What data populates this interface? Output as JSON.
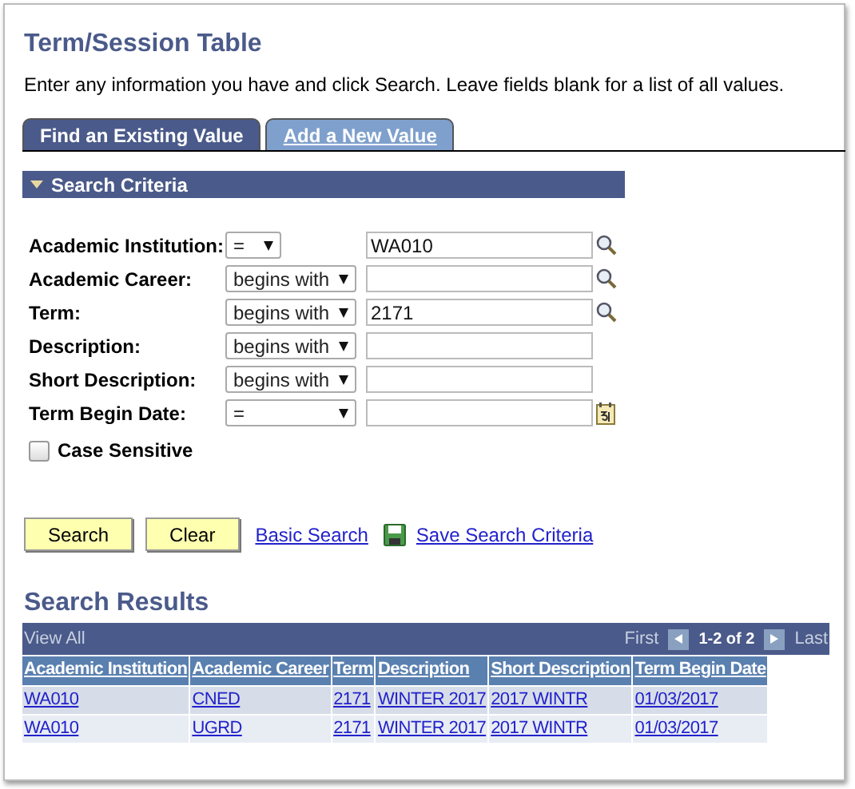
{
  "page": {
    "title": "Term/Session Table",
    "instructions": "Enter any information you have and click Search. Leave fields blank for a list of all values."
  },
  "tabs": [
    {
      "label": "Find an Existing Value",
      "selected": true
    },
    {
      "label": "Add a New Value",
      "selected": false
    }
  ],
  "section": {
    "title": "Search Criteria",
    "expanded": true
  },
  "fields": [
    {
      "label": "Academic Institution:",
      "operator": "=",
      "value": "WA010",
      "kind": "lookup"
    },
    {
      "label": "Academic Career:",
      "operator": "begins with",
      "kind": "lookup"
    },
    {
      "label": "Term:",
      "operator": "begins with",
      "value": "2171",
      "kind": "lookup"
    },
    {
      "label": "Description:",
      "operator": "begins with",
      "kind": "plain"
    },
    {
      "label": "Short Description:",
      "operator": "begins with",
      "kind": "plain"
    },
    {
      "label": "Term Begin Date:",
      "operator": "=",
      "kind": "date"
    }
  ],
  "case_sensitive": {
    "label": "Case Sensitive",
    "checked": false
  },
  "buttons": [
    "Search",
    "Clear"
  ],
  "links": [
    {
      "label": "Basic Search",
      "kind": "plain"
    },
    {
      "label": "Save Search Criteria",
      "kind": "save"
    }
  ],
  "results": {
    "title": "Search Results",
    "view_all": "View All",
    "first": "First",
    "range": "1-2 of 2",
    "last": "Last",
    "columns": [
      "Academic Institution",
      "Academic Career",
      "Term",
      "Description",
      "Short Description",
      "Term Begin Date"
    ],
    "rows": [
      [
        "WA010",
        "CNED",
        "2171",
        "WINTER 2017",
        "2017 WINTR",
        "01/03/2017"
      ],
      [
        "WA010",
        "UGRD",
        "2171",
        "WINTER 2017",
        "2017 WINTR",
        "01/03/2017"
      ]
    ]
  }
}
